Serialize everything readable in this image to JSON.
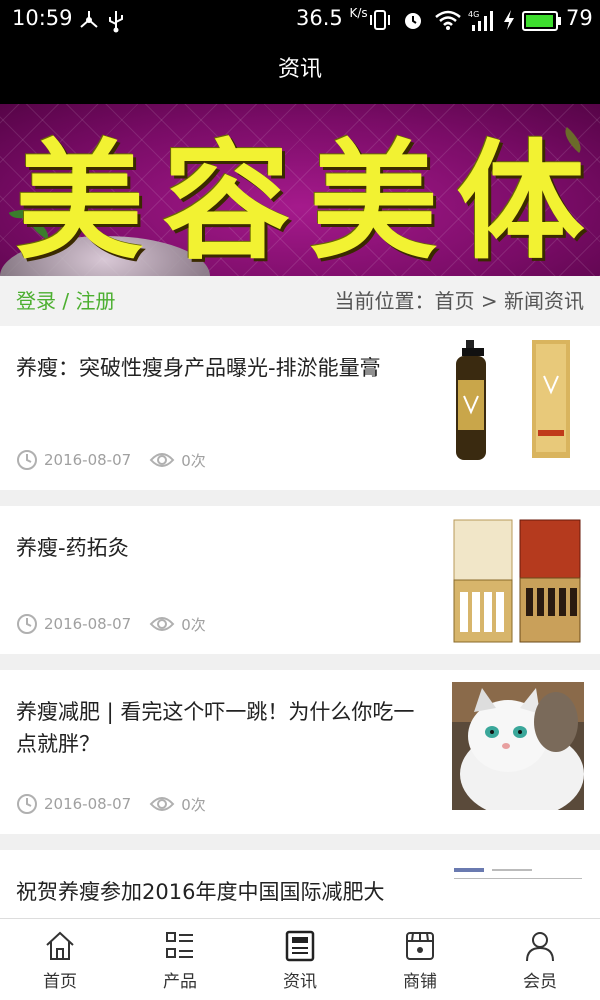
{
  "status_bar": {
    "time": "10:59",
    "speed": "36.5",
    "speed_unit": "K/s",
    "battery": "79",
    "icons": [
      "usb-share-icon",
      "usb-icon",
      "vibrate-icon",
      "alarm-icon",
      "wifi-icon",
      "signal-4g-icon",
      "charging-icon",
      "battery-icon"
    ]
  },
  "header": {
    "title": "资讯"
  },
  "banner": {
    "text": [
      "美",
      "容",
      "美",
      "体"
    ],
    "text_color": "#f2f232",
    "bg_color": "#7a0c67"
  },
  "breadcrumb": {
    "login": "登录",
    "separator": " / ",
    "register": "注册",
    "location": "当前位置：首页 > 新闻资讯"
  },
  "news": [
    {
      "title": "养瘦：突破性瘦身产品曝光-排淤能量膏",
      "date": "2016-08-07",
      "views": "0次",
      "thumb": "bottle-product"
    },
    {
      "title": "养瘦-药拓灸",
      "date": "2016-08-07",
      "views": "0次",
      "thumb": "gift-box-set"
    },
    {
      "title": "养瘦减肥 | 看完这个吓一跳！为什么你吃一点就胖？",
      "date": "2016-08-07",
      "views": "0次",
      "thumb": "fat-cat"
    },
    {
      "title": "祝贺养瘦参加2016年度中国国际减肥大",
      "date": "",
      "views": "",
      "thumb": "document"
    }
  ],
  "bottom_nav": [
    {
      "label": "首页",
      "icon": "home-icon"
    },
    {
      "label": "产品",
      "icon": "product-list-icon"
    },
    {
      "label": "资讯",
      "icon": "news-icon"
    },
    {
      "label": "商铺",
      "icon": "shop-icon"
    },
    {
      "label": "会员",
      "icon": "member-icon"
    }
  ],
  "colors": {
    "accent_green": "#4caf30",
    "header_bg": "#000000",
    "meta_gray": "#a0a0a0"
  }
}
